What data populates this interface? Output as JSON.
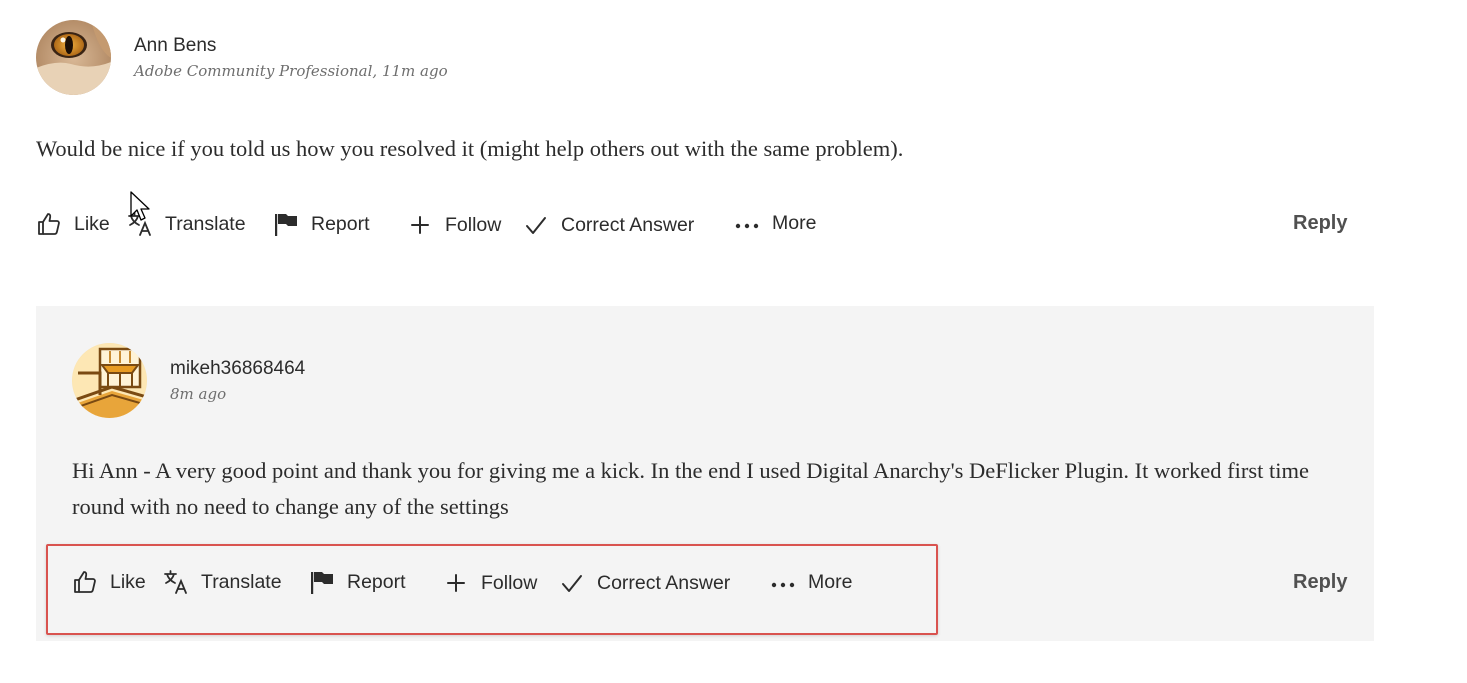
{
  "post": {
    "author_name": "Ann Bens",
    "author_meta": "Adobe Community Professional, 11m ago",
    "body": "Would be nice if you told us how you resolved it (might help others out with the same problem).",
    "avatar_icon": "cat-eye-avatar",
    "actions": {
      "like": "Like",
      "translate": "Translate",
      "report": "Report",
      "follow": "Follow",
      "correct_answer": "Correct Answer",
      "more": "More",
      "reply": "Reply"
    }
  },
  "reply": {
    "author_name": "mikeh36868464",
    "author_meta": "8m ago",
    "body": "Hi Ann - A very good point and thank you for giving me a kick. In the end I used Digital Anarchy's DeFlicker Plugin. It worked first time round with no need to change any of the settings",
    "avatar_icon": "building-avatar",
    "actions": {
      "like": "Like",
      "translate": "Translate",
      "report": "Report",
      "follow": "Follow",
      "correct_answer": "Correct Answer",
      "more": "More",
      "reply": "Reply"
    }
  },
  "colors": {
    "text": "#2c2c2c",
    "meta": "#6e6e6e",
    "panel_bg": "#f4f4f4",
    "highlight_border": "#d9534f"
  }
}
